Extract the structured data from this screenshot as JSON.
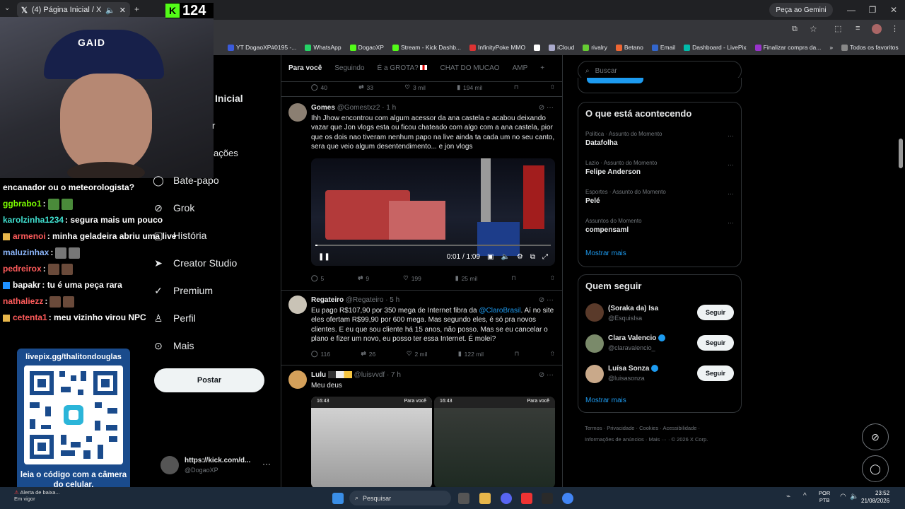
{
  "browser": {
    "tab_title": "(4) Página Inicial / X",
    "gemini_label": "Peça ao Gemini",
    "bookmarks": [
      "YT DogaoXP#0195 -...",
      "WhatsApp",
      "DogaoXP",
      "Stream - Kick Dashb...",
      "InfinityPoke MMO",
      "",
      "iCloud",
      "rivalry",
      "Betano",
      "Email",
      "Dashboard - LivePix",
      "Finalizar compra da..."
    ],
    "bookmarks_folder": "Todos os favoritos"
  },
  "stream": {
    "kick_viewers": "124",
    "cap_logo": "GAID"
  },
  "chat": [
    {
      "user": "",
      "text": "encanador ou o meteorologista?",
      "color": "#ffffff",
      "emotes": 0
    },
    {
      "user": "ggbrabo1",
      "text": ":",
      "color": "#7CFC00",
      "emotes": 2
    },
    {
      "user": "karolzinha1234",
      "text": ": segura mais um pouco",
      "color": "#40E0D0",
      "emotes": 0
    },
    {
      "user": "armenoi",
      "text": ": minha geladeira abriu uma live",
      "color": "#ff5b5b",
      "emotes": 0
    },
    {
      "user": "maluzinhax",
      "text": ":",
      "color": "#8ab4f8",
      "emotes": 2
    },
    {
      "user": "pedreirox",
      "text": ":",
      "color": "#ff5b5b",
      "emotes": 2
    },
    {
      "user": "bapakr",
      "text": ": tu é uma peça rara",
      "color": "#ffffff",
      "emotes": 0
    },
    {
      "user": "nathaliezz",
      "text": ":",
      "color": "#ff5b5b",
      "emotes": 2
    },
    {
      "user": "cetenta1",
      "text": ": meu vizinho virou NPC",
      "color": "#ff5b5b",
      "emotes": 0
    }
  ],
  "qr": {
    "url": "livepix.gg/thalitondouglas",
    "caption": "leia o código com a câmera do celular."
  },
  "nav": {
    "partial_items": [
      "Inicial",
      "r",
      "ações"
    ],
    "items": [
      "Bate-papo",
      "Grok",
      "História",
      "Creator Studio",
      "Premium",
      "Perfil",
      "Mais"
    ],
    "post_button": "Postar",
    "account_name": "https://kick.com/d...",
    "account_handle": "@DogaoXP"
  },
  "feed": {
    "tabs": [
      "Para você",
      "Seguindo",
      "É a GROTA?",
      "CHAT DO MUCAO",
      "AMP",
      "+"
    ],
    "top_actions": {
      "replies": "40",
      "reposts": "33",
      "likes": "3 mil",
      "views": "194 mil"
    },
    "posts": [
      {
        "name": "Gomes",
        "handle": "@Gomestxz2",
        "time": "· 1 h",
        "text": "Ihh Jhow encontrou com algum acessor da ana castela e acabou deixando vazar que Jon vlogs esta ou ficou chateado com algo com a ana castela, pior que os dois nao tiveram nenhum papo na live ainda ta cada um no seu canto, sera que veio algum desentendimento... e jon vlogs",
        "video_time": "0:01 / 1:09",
        "actions": {
          "replies": "5",
          "reposts": "9",
          "likes": "199",
          "views": "25 mil"
        }
      },
      {
        "name": "Regateiro",
        "handle": "@Regateiro",
        "time": "· 5 h",
        "text_pre": "Eu pago R$107,90 por 350 mega de Internet fibra da ",
        "mention": "@ClaroBrasil",
        "text_post": ". Aí no site eles ofertam R$99,90 por 600 mega. Mas segundo eles, é só pra novos clientes. E eu que sou cliente há 15 anos, não posso. Mas se eu cancelar o plano e fizer um novo, eu posso ter essa Internet. É molei?",
        "actions": {
          "replies": "116",
          "reposts": "26",
          "likes": "2 mil",
          "views": "122 mil"
        }
      },
      {
        "name": "Lulu",
        "handle": "@luisvvdf",
        "time": "· 7 h",
        "text": "Meu deus",
        "thumb1_time": "16:43",
        "thumb2_time": "16:43",
        "thumb_tab": "Para você"
      }
    ]
  },
  "sidebar": {
    "search_placeholder": "Buscar",
    "trends_title": "O que está acontecendo",
    "trends": [
      {
        "category": "Política · Assunto do Momento",
        "name": "Datafolha"
      },
      {
        "category": "Lazio · Assunto do Momento",
        "name": "Felipe Anderson"
      },
      {
        "category": "Esportes · Assunto do Momento",
        "name": "Pelé"
      },
      {
        "category": "Assuntos do Momento",
        "name": "compensaml"
      }
    ],
    "show_more": "Mostrar mais",
    "follow_title": "Quem seguir",
    "follow": [
      {
        "name": "(Soraka da) Isa",
        "handle": "@EsquisIsa",
        "verified": false
      },
      {
        "name": "Clara Valencio",
        "handle": "@claravalencio_",
        "verified": true
      },
      {
        "name": "Luísa Sonza",
        "handle": "@luisasonza",
        "verified": true
      }
    ],
    "follow_button": "Seguir",
    "footer_line1": "Termos · Privacidade · Cookies · Acessibilidade ·",
    "footer_line2": "Informações de anúncios · Mais ··· · © 2026 X Corp."
  },
  "taskbar": {
    "search_placeholder": "Pesquisar",
    "alert_line1": "Alerta de baixa...",
    "alert_line2": "Em vigor",
    "lang_line1": "POR",
    "lang_line2": "PTB",
    "time": "23:52",
    "date": "21/08/2026"
  }
}
